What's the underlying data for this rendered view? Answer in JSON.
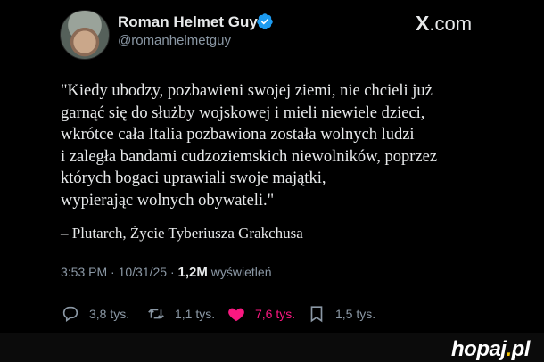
{
  "author": {
    "name": "Roman Helmet Guy",
    "handle": "@romanhelmetguy"
  },
  "brand": {
    "x": "X",
    "domain": ".com"
  },
  "quote_lines": [
    "\"Kiedy ubodzy, pozbawieni swojej ziemi, nie chcieli już",
    "garnąć się do służby wojskowej i mieli niewiele dzieci,",
    "wkrótce cała Italia pozbawiona została wolnych ludzi",
    "i zaległa bandami cudzoziemskich niewolników, poprzez",
    "których bogaci uprawiali swoje majątki,",
    "wypierając wolnych obywateli.\""
  ],
  "attribution": "– Plutarch, Życie Tyberiusza Grakchusa",
  "meta": {
    "time": "3:53 PM",
    "sep1": " · ",
    "date": "10/31/25",
    "sep2": " · ",
    "views": "1,2M",
    "views_label": " wyświetleń"
  },
  "actions": {
    "replies": "3,8 tys.",
    "reposts": "1,1 tys.",
    "likes": "7,6 tys.",
    "bookmarks": "1,5 tys."
  },
  "watermark": {
    "text": "hopaj",
    "dot": ".",
    "tld": "pl"
  },
  "colors": {
    "background": "#000000",
    "text": "#e7e9ea",
    "muted": "#8b98a5",
    "verified": "#1d9bf0",
    "like": "#f91880",
    "watermark_accent": "#f5c400"
  }
}
